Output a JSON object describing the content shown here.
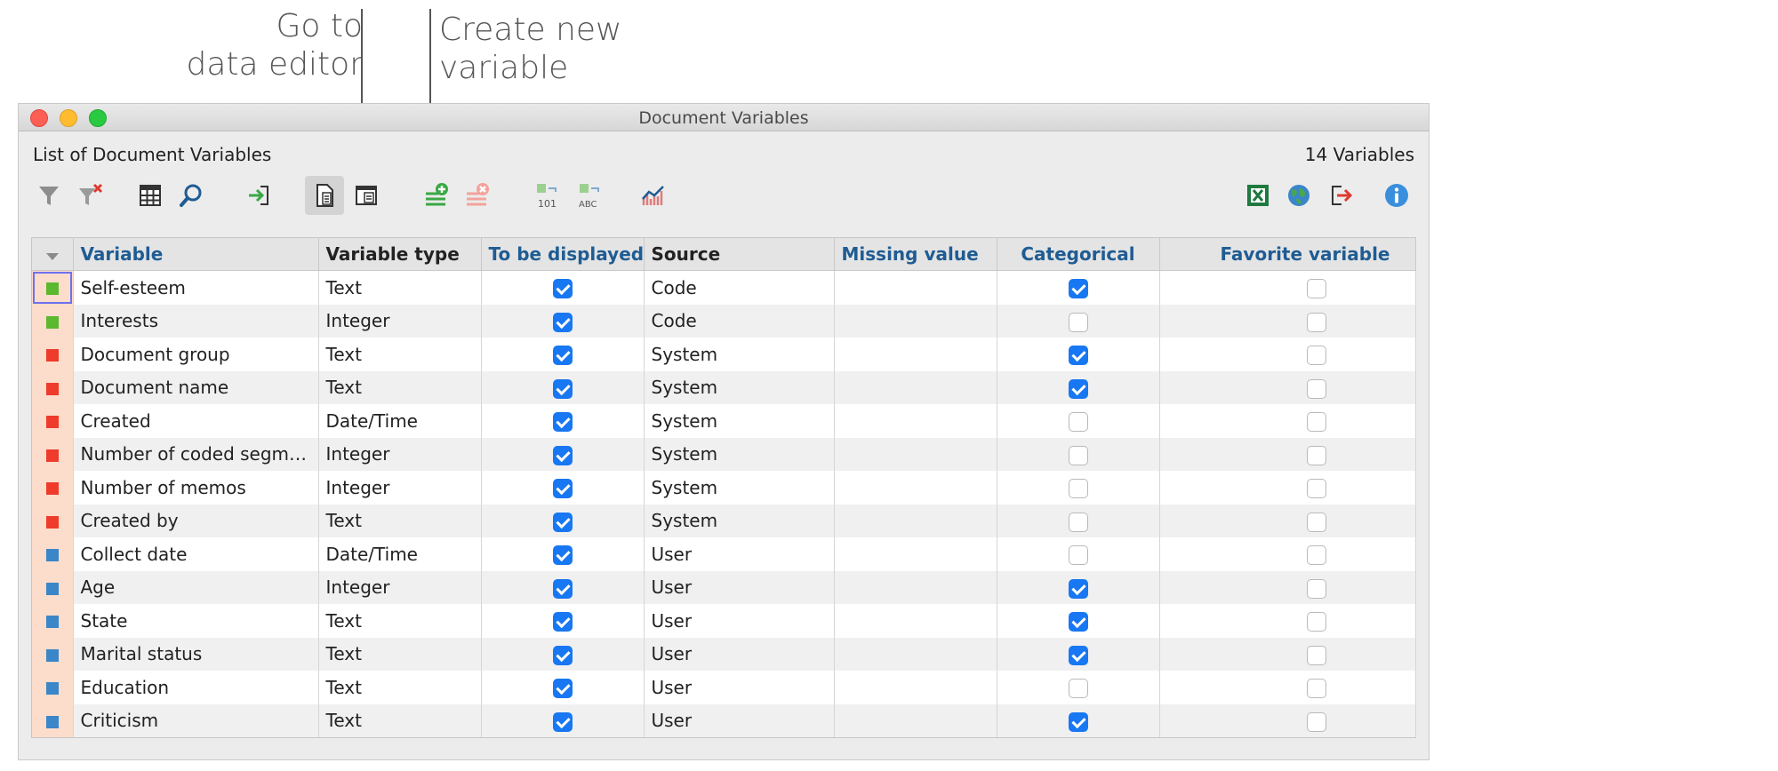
{
  "annotations": {
    "data_editor": [
      "Go to",
      "data editor"
    ],
    "create_variable": [
      "Create new",
      "variable"
    ]
  },
  "window": {
    "title": "Document Variables",
    "list_title": "List of Document Variables",
    "variable_count": "14 Variables"
  },
  "toolbar": {
    "left": [
      "filter-icon",
      "clear-filter-icon",
      "columns-icon",
      "search-icon",
      "import-icon",
      "variable-list-icon",
      "data-editor-icon",
      "new-variable-icon",
      "delete-variable-icon",
      "convert-to-numeric-icon",
      "convert-to-text-icon",
      "statistics-icon"
    ],
    "right": [
      "excel-export-icon",
      "html-export-icon",
      "export-icon",
      "info-icon"
    ]
  },
  "colors": {
    "code": "#5cb82e",
    "system": "#ee3b2b",
    "user": "#3a86c8",
    "checkbox": "#1877f2",
    "header_blue": "#1f5c93"
  },
  "table": {
    "headers": {
      "variable": "Variable",
      "type": "Variable type",
      "displayed": "To be displayed",
      "source": "Source",
      "missing": "Missing value",
      "categorical": "Categorical",
      "favorite": "Favorite variable"
    },
    "rows": [
      {
        "name": "Self-esteem",
        "type": "Text",
        "displayed": true,
        "source": "Code",
        "missing": "",
        "categorical": true,
        "favorite": false,
        "color": "code"
      },
      {
        "name": "Interests",
        "type": "Integer",
        "displayed": true,
        "source": "Code",
        "missing": "",
        "categorical": false,
        "favorite": false,
        "color": "code"
      },
      {
        "name": "Document group",
        "type": "Text",
        "displayed": true,
        "source": "System",
        "missing": "",
        "categorical": true,
        "favorite": false,
        "color": "system"
      },
      {
        "name": "Document name",
        "type": "Text",
        "displayed": true,
        "source": "System",
        "missing": "",
        "categorical": true,
        "favorite": false,
        "color": "system"
      },
      {
        "name": "Created",
        "type": "Date/Time",
        "displayed": true,
        "source": "System",
        "missing": "",
        "categorical": false,
        "favorite": false,
        "color": "system"
      },
      {
        "name": "Number of coded segme...",
        "type": "Integer",
        "displayed": true,
        "source": "System",
        "missing": "",
        "categorical": false,
        "favorite": false,
        "color": "system"
      },
      {
        "name": "Number of memos",
        "type": "Integer",
        "displayed": true,
        "source": "System",
        "missing": "",
        "categorical": false,
        "favorite": false,
        "color": "system"
      },
      {
        "name": "Created by",
        "type": "Text",
        "displayed": true,
        "source": "System",
        "missing": "",
        "categorical": false,
        "favorite": false,
        "color": "system"
      },
      {
        "name": "Collect date",
        "type": "Date/Time",
        "displayed": true,
        "source": "User",
        "missing": "",
        "categorical": false,
        "favorite": false,
        "color": "user"
      },
      {
        "name": "Age",
        "type": "Integer",
        "displayed": true,
        "source": "User",
        "missing": "",
        "categorical": true,
        "favorite": false,
        "color": "user"
      },
      {
        "name": "State",
        "type": "Text",
        "displayed": true,
        "source": "User",
        "missing": "",
        "categorical": true,
        "favorite": false,
        "color": "user"
      },
      {
        "name": "Marital status",
        "type": "Text",
        "displayed": true,
        "source": "User",
        "missing": "",
        "categorical": true,
        "favorite": false,
        "color": "user"
      },
      {
        "name": "Education",
        "type": "Text",
        "displayed": true,
        "source": "User",
        "missing": "",
        "categorical": false,
        "favorite": false,
        "color": "user"
      },
      {
        "name": "Criticism",
        "type": "Text",
        "displayed": true,
        "source": "User",
        "missing": "",
        "categorical": true,
        "favorite": false,
        "color": "user"
      }
    ]
  }
}
